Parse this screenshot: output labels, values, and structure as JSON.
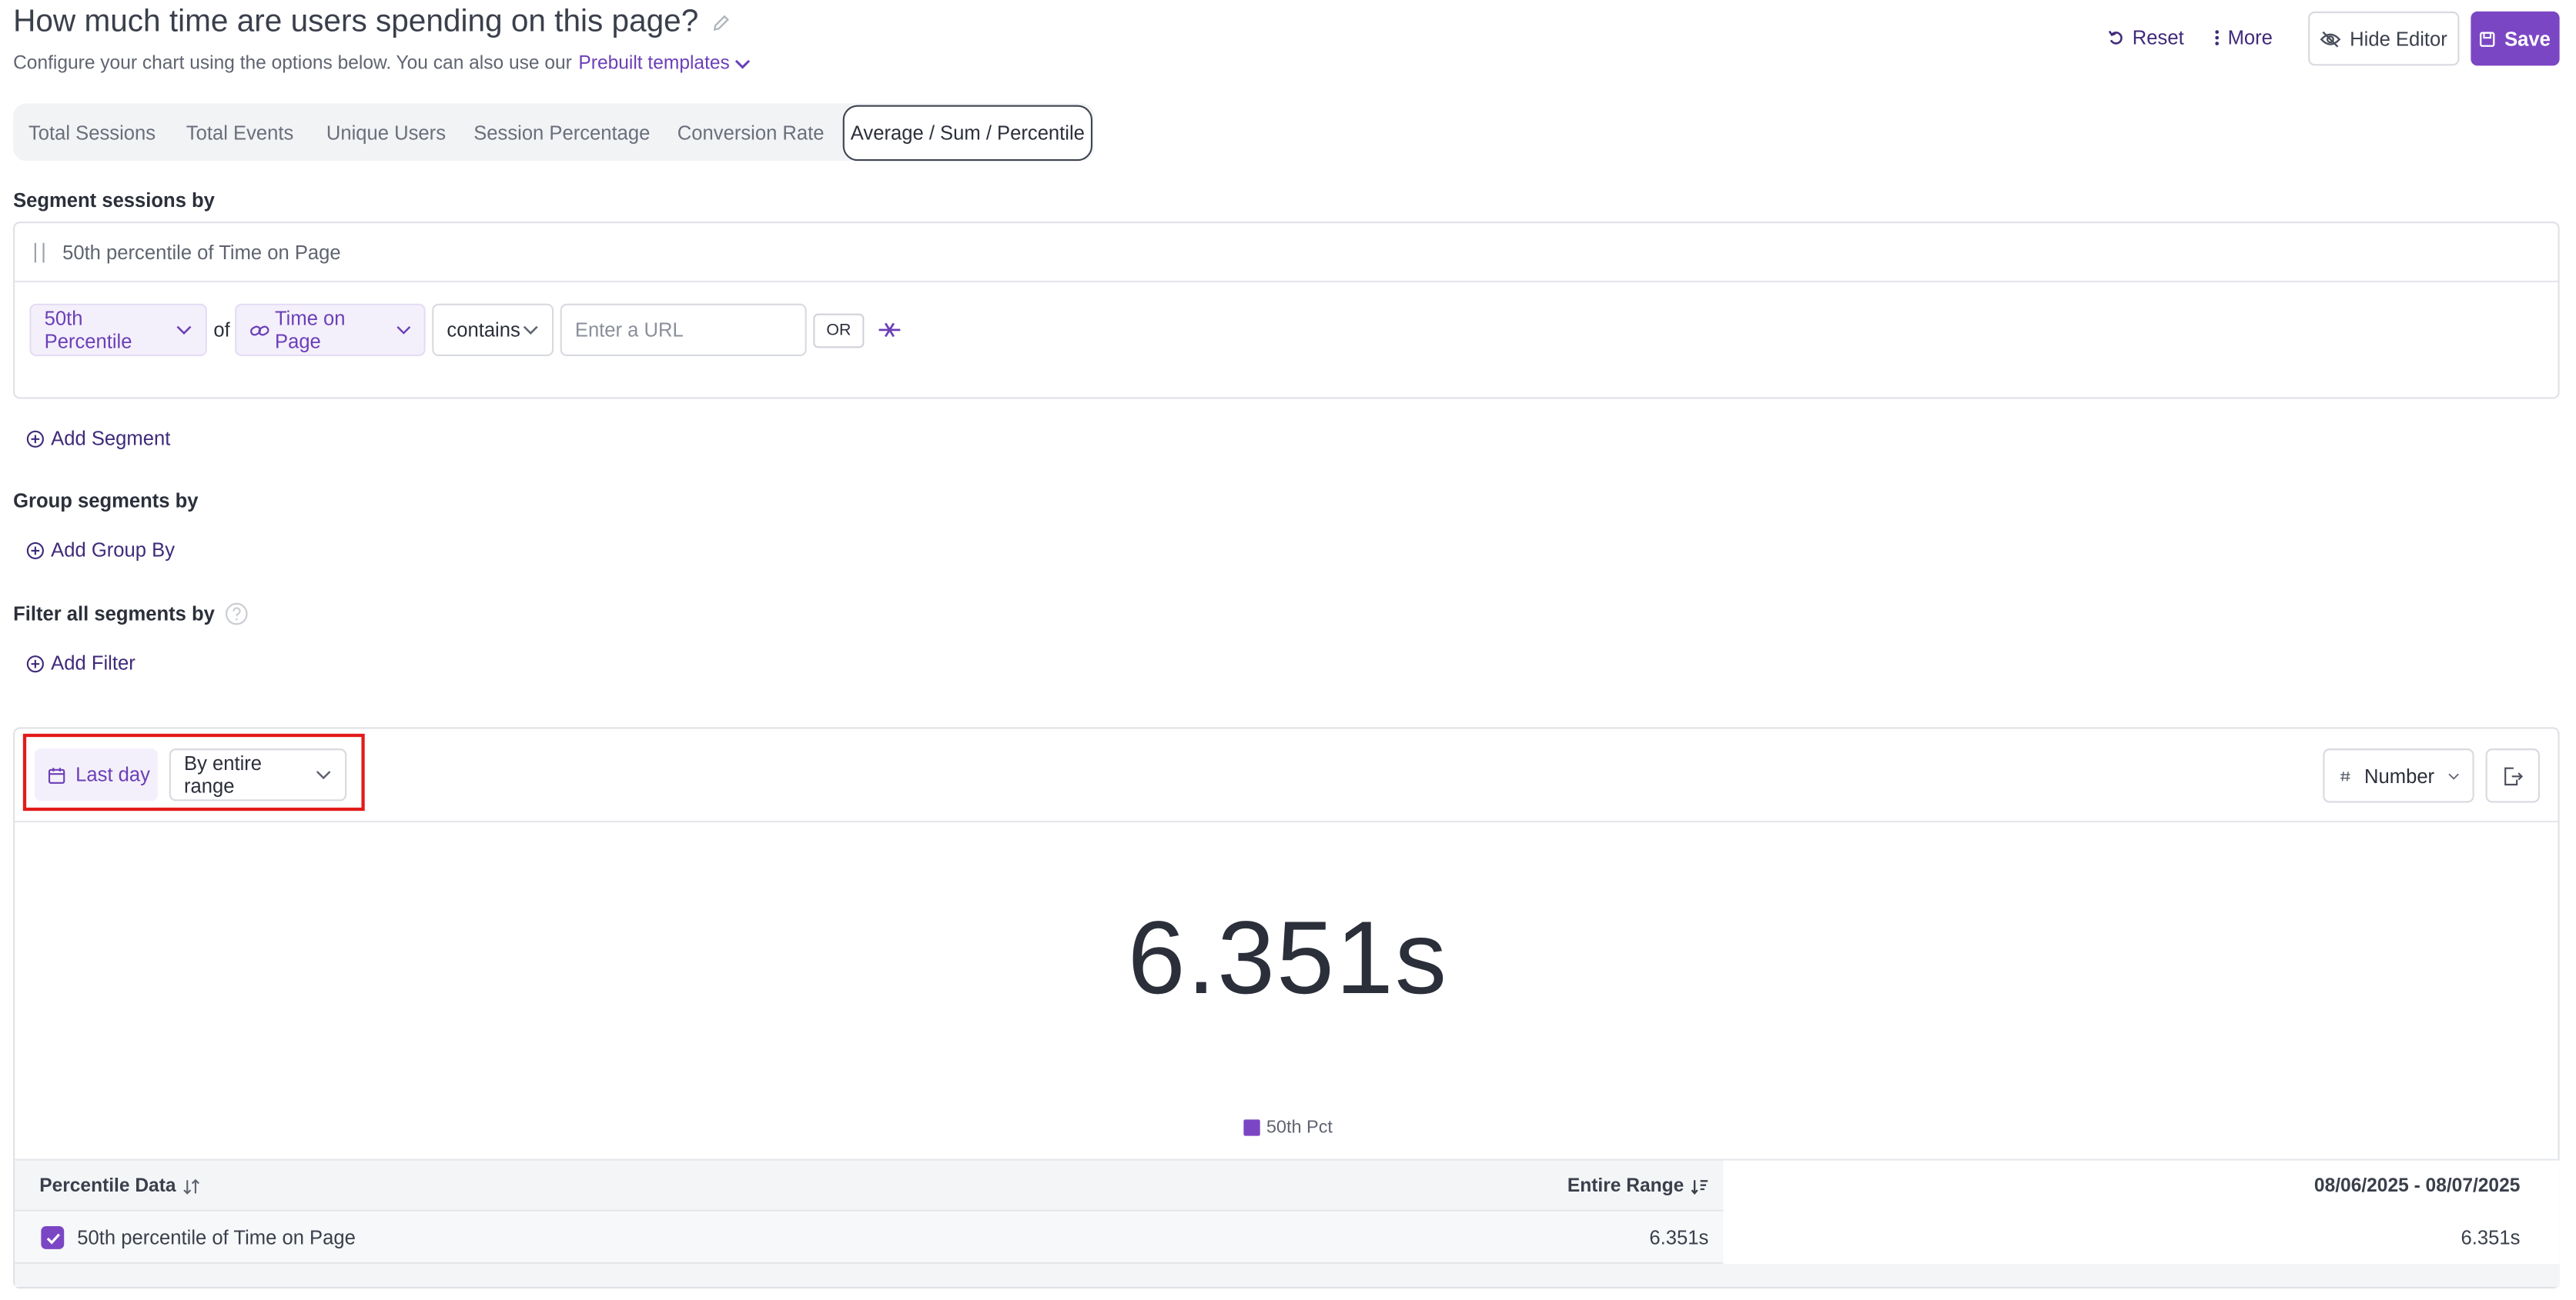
{
  "header": {
    "title": "How much time are users spending on this page?",
    "subtitle": "Configure your chart using the options below. You can also use our",
    "prebuilt_link": "Prebuilt templates",
    "reset_label": "Reset",
    "more_label": "More",
    "hide_editor_label": "Hide Editor",
    "save_label": "Save"
  },
  "tabs": [
    {
      "label": "Total Sessions",
      "active": false
    },
    {
      "label": "Total Events",
      "active": false
    },
    {
      "label": "Unique Users",
      "active": false
    },
    {
      "label": "Session Percentage",
      "active": false
    },
    {
      "label": "Conversion Rate",
      "active": false
    },
    {
      "label": "Average / Sum / Percentile",
      "active": true
    }
  ],
  "segment": {
    "section_label": "Segment sessions by",
    "name": "50th percentile of Time on Page",
    "aggregation": "50th Percentile",
    "of_label": "of",
    "property": "Time on Page",
    "operator": "contains",
    "url_placeholder": "Enter a URL",
    "or_label": "OR",
    "add_label": "Add Segment"
  },
  "group": {
    "section_label": "Group segments by",
    "add_label": "Add Group By"
  },
  "filter": {
    "section_label": "Filter all segments by",
    "add_label": "Add Filter"
  },
  "chart_toolbar": {
    "date_range": "Last day",
    "interval": "By entire range",
    "format": "Number"
  },
  "result": {
    "big_value": "6.351s",
    "legend_label": "50th Pct"
  },
  "table": {
    "headers": {
      "name": "Percentile Data",
      "entire_range": "Entire Range",
      "date_col": "08/06/2025 - 08/07/2025"
    },
    "rows": [
      {
        "name": "50th percentile of Time on Page",
        "entire_range": "6.351s",
        "date_value": "6.351s",
        "checked": true
      }
    ]
  },
  "colors": {
    "accent": "#7b46c4",
    "link": "#6b3fb7",
    "highlight_border": "#e31b1b"
  }
}
